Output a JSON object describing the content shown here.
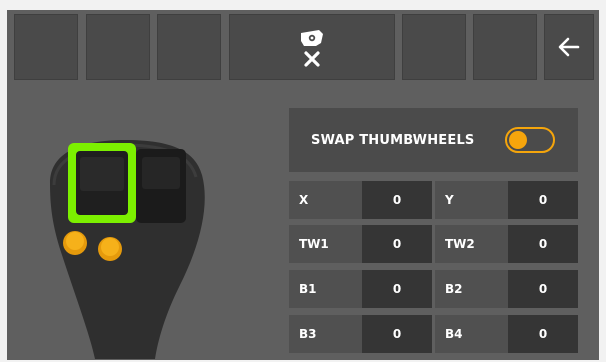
{
  "toolbar": {
    "buttons": [
      {
        "name": "toolbar-slot-1"
      },
      {
        "name": "toolbar-slot-2"
      },
      {
        "name": "toolbar-slot-3"
      },
      {
        "name": "toolbar-slot-camera-close",
        "icon": "camera-x-icon"
      },
      {
        "name": "toolbar-slot-5"
      },
      {
        "name": "toolbar-slot-6"
      },
      {
        "name": "toolbar-back",
        "icon": "arrow-left-icon"
      }
    ]
  },
  "swap": {
    "label": "SWAP THUMBWHEELS",
    "enabled": true
  },
  "readings": [
    {
      "label": "X",
      "value": "0"
    },
    {
      "label": "Y",
      "value": "0"
    },
    {
      "label": "TW1",
      "value": "0"
    },
    {
      "label": "TW2",
      "value": "0"
    },
    {
      "label": "B1",
      "value": "0"
    },
    {
      "label": "B2",
      "value": "0"
    },
    {
      "label": "B3",
      "value": "0"
    },
    {
      "label": "B4",
      "value": "0"
    }
  ],
  "colors": {
    "accent": "#f6a50c",
    "highlight": "#7cf000",
    "panel": "#4b4b4b",
    "background": "#5f5f5f"
  }
}
